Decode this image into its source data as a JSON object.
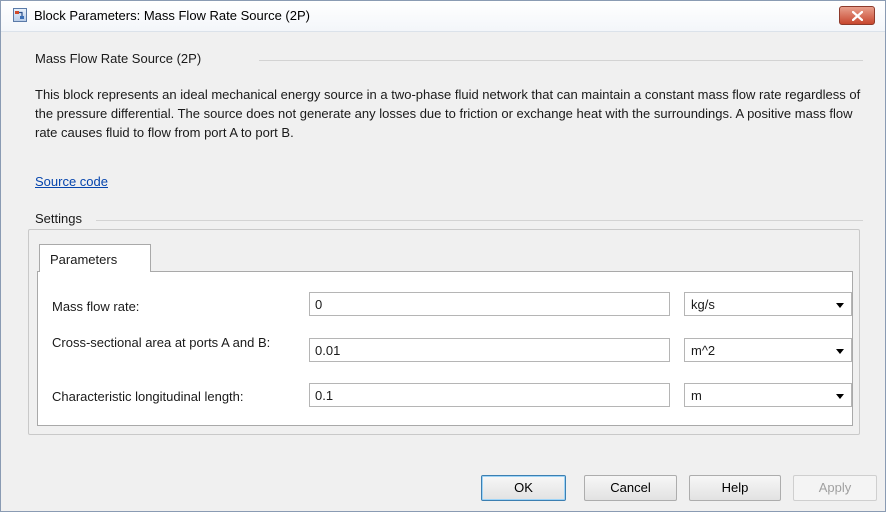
{
  "window": {
    "title": "Block Parameters: Mass Flow Rate Source (2P)"
  },
  "block": {
    "group_label": "Mass Flow Rate Source (2P)",
    "description": "This block represents an ideal mechanical energy source in a two-phase fluid network that can maintain a constant mass flow rate regardless of the pressure differential. The source does not generate any losses due to friction or exchange heat with the surroundings. A positive mass flow rate causes fluid to flow from port A to port B.",
    "source_link": "Source code"
  },
  "settings": {
    "group_label": "Settings",
    "tab_label": "Parameters",
    "params": [
      {
        "label": "Mass flow rate:",
        "value": "0",
        "unit": "kg/s"
      },
      {
        "label": "Cross-sectional area at ports A and B:",
        "value": "0.01",
        "unit": "m^2"
      },
      {
        "label": "Characteristic longitudinal length:",
        "value": "0.1",
        "unit": "m"
      }
    ]
  },
  "buttons": {
    "ok": "OK",
    "cancel": "Cancel",
    "help": "Help",
    "apply": "Apply"
  },
  "icons": {
    "app": "simulink-block-icon",
    "close": "close-icon",
    "dropdown": "chevron-down-icon"
  },
  "colors": {
    "close_button": "#c7472f",
    "link": "#0645ad",
    "ok_focus": "#3c7fb1"
  }
}
